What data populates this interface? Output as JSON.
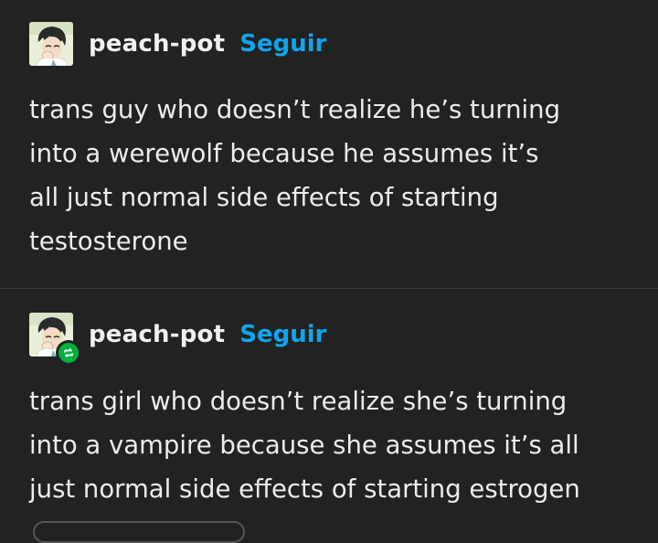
{
  "colors": {
    "background": "#222222",
    "text": "#ececec",
    "follow_link": "#0ea5ee",
    "reblog_badge": "#00b140"
  },
  "posts": [
    {
      "username": "peach-pot",
      "follow_label": "Seguir",
      "avatar_icon": "user-avatar-icon",
      "text": "trans guy who doesn’t realize he’s turning into a werewolf because he assumes it’s all just normal side effects of starting testosterone",
      "lines": [
        "trans guy who doesn’t realize he’s turning",
        "into a werewolf because he assumes it’s",
        "all just normal side effects of starting",
        "testosterone"
      ]
    },
    {
      "username": "peach-pot",
      "follow_label": "Seguir",
      "avatar_icon": "user-avatar-icon",
      "badge_icon": "reblog-icon",
      "lines": [
        "trans girl who doesn’t realize she’s turning",
        "into a vampire because she assumes it’s all",
        "just normal side effects of starting estrogen"
      ]
    }
  ]
}
